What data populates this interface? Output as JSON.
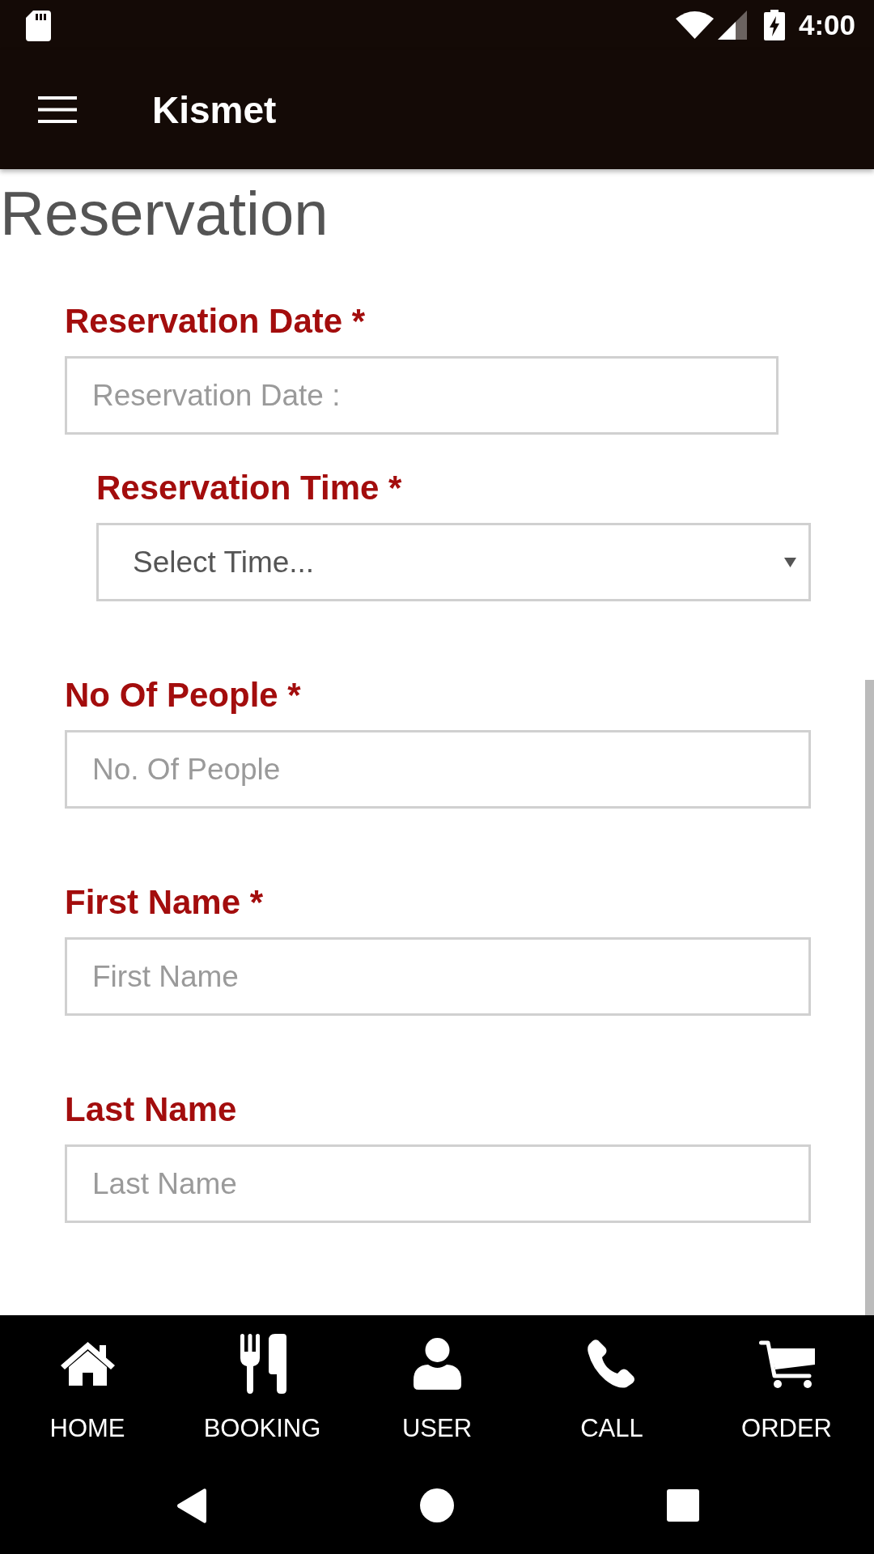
{
  "status_bar": {
    "time": "4:00"
  },
  "app_bar": {
    "title": "Kismet"
  },
  "page": {
    "heading": "Reservation"
  },
  "form": {
    "fields": [
      {
        "kind": "date",
        "label": "Reservation Date *",
        "placeholder": "Reservation Date :"
      },
      {
        "kind": "select",
        "label": "Reservation Time *",
        "value": "Select Time..."
      },
      {
        "kind": "text",
        "label": "No Of People *",
        "placeholder": "No. Of People"
      },
      {
        "kind": "text",
        "label": "First Name *",
        "placeholder": "First Name"
      },
      {
        "kind": "text",
        "label": "Last Name",
        "placeholder": "Last Name"
      }
    ]
  },
  "bottom_nav": {
    "items": [
      {
        "label": "HOME"
      },
      {
        "label": "BOOKING"
      },
      {
        "label": "USER"
      },
      {
        "label": "CALL"
      },
      {
        "label": "ORDER"
      }
    ]
  }
}
